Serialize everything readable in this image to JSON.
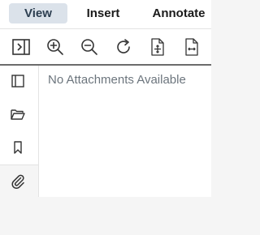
{
  "tabs": [
    {
      "label": "View",
      "active": true
    },
    {
      "label": "Insert",
      "active": false
    },
    {
      "label": "Annotate",
      "active": false
    }
  ],
  "toolbar": {
    "tools": [
      "panel-toggle-icon",
      "zoom-in-icon",
      "zoom-out-icon",
      "rotate-icon",
      "fit-page-icon",
      "fit-width-icon"
    ]
  },
  "sidebar": {
    "items": [
      "thumbnails-icon",
      "outline-icon",
      "bookmark-icon",
      "attachment-icon"
    ],
    "active_item": "attachment-icon"
  },
  "attachments_panel": {
    "empty_message": "No Attachments Available"
  },
  "colors": {
    "active_tab_bg": "#dbe2ea",
    "empty_text": "#6c757d",
    "icon": "#333333"
  }
}
